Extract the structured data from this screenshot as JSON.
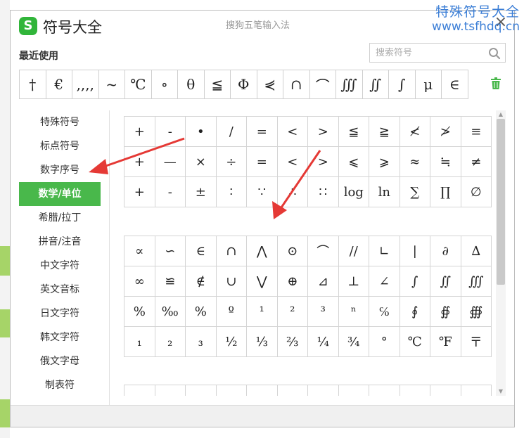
{
  "watermark": {
    "line1": "特殊符号大全",
    "line2": "www.tsfhdq.cn"
  },
  "window": {
    "title": "符号大全",
    "ime_name": "搜狗五笔输入法",
    "logo_letter": "S",
    "close_symbol": "×"
  },
  "recent": {
    "label": "最近使用",
    "symbols": [
      "†",
      "€",
      "‚,,,",
      "~",
      "℃",
      "∘",
      "θ",
      "≦",
      "Φ",
      "⋞",
      "∩",
      "⌒",
      "∭",
      "∬",
      "∫",
      "μ",
      "∈"
    ]
  },
  "search": {
    "placeholder": "搜索符号",
    "value": ""
  },
  "categories": [
    {
      "label": "特殊符号",
      "active": false
    },
    {
      "label": "标点符号",
      "active": false
    },
    {
      "label": "数字序号",
      "active": false
    },
    {
      "label": "数学/单位",
      "active": true
    },
    {
      "label": "希腊/拉丁",
      "active": false
    },
    {
      "label": "拼音/注音",
      "active": false
    },
    {
      "label": "中文字符",
      "active": false
    },
    {
      "label": "英文音标",
      "active": false
    },
    {
      "label": "日文字符",
      "active": false
    },
    {
      "label": "韩文字符",
      "active": false
    },
    {
      "label": "俄文字母",
      "active": false
    },
    {
      "label": "制表符",
      "active": false
    }
  ],
  "grid1": [
    [
      "+",
      "-",
      "•",
      "/",
      "=",
      "<",
      ">",
      "≦",
      "≧",
      "≮",
      "≯",
      "≡"
    ],
    [
      "+",
      "—",
      "×",
      "÷",
      "=",
      "<",
      ">",
      "⩽",
      "⩾",
      "≈",
      "≒",
      "≠"
    ],
    [
      "+",
      "-",
      "±",
      "∶",
      "∵",
      "∴",
      "∷",
      "log",
      "ln",
      "∑",
      "∏",
      "∅"
    ]
  ],
  "grid2": [
    [
      "∝",
      "∽",
      "∈",
      "∩",
      "⋀",
      "⊙",
      "⌒",
      "//",
      "∟",
      "|",
      "∂",
      "∆"
    ],
    [
      "∞",
      "≌",
      "∉",
      "∪",
      "⋁",
      "⊕",
      "⊿",
      "⊥",
      "∠",
      "∫",
      "∬",
      "∭"
    ],
    [
      "%",
      "‰",
      "%",
      "º",
      "¹",
      "²",
      "³",
      "ⁿ",
      "℅",
      "∮",
      "∯",
      "∰"
    ],
    [
      "₁",
      "₂",
      "₃",
      "½",
      "⅓",
      "⅔",
      "¼",
      "¾",
      "°",
      "℃",
      "℉",
      "〒"
    ]
  ],
  "grid3": [
    [
      "",
      "",
      "",
      "",
      "",
      "",
      "",
      "",
      "",
      "",
      "",
      ""
    ]
  ],
  "colors": {
    "accent": "#49b84b",
    "arrow": "#e53935",
    "watermark": "#3b7ed6"
  },
  "icons": {
    "search": "search-icon",
    "trash": "trash-icon",
    "close": "close-icon"
  }
}
